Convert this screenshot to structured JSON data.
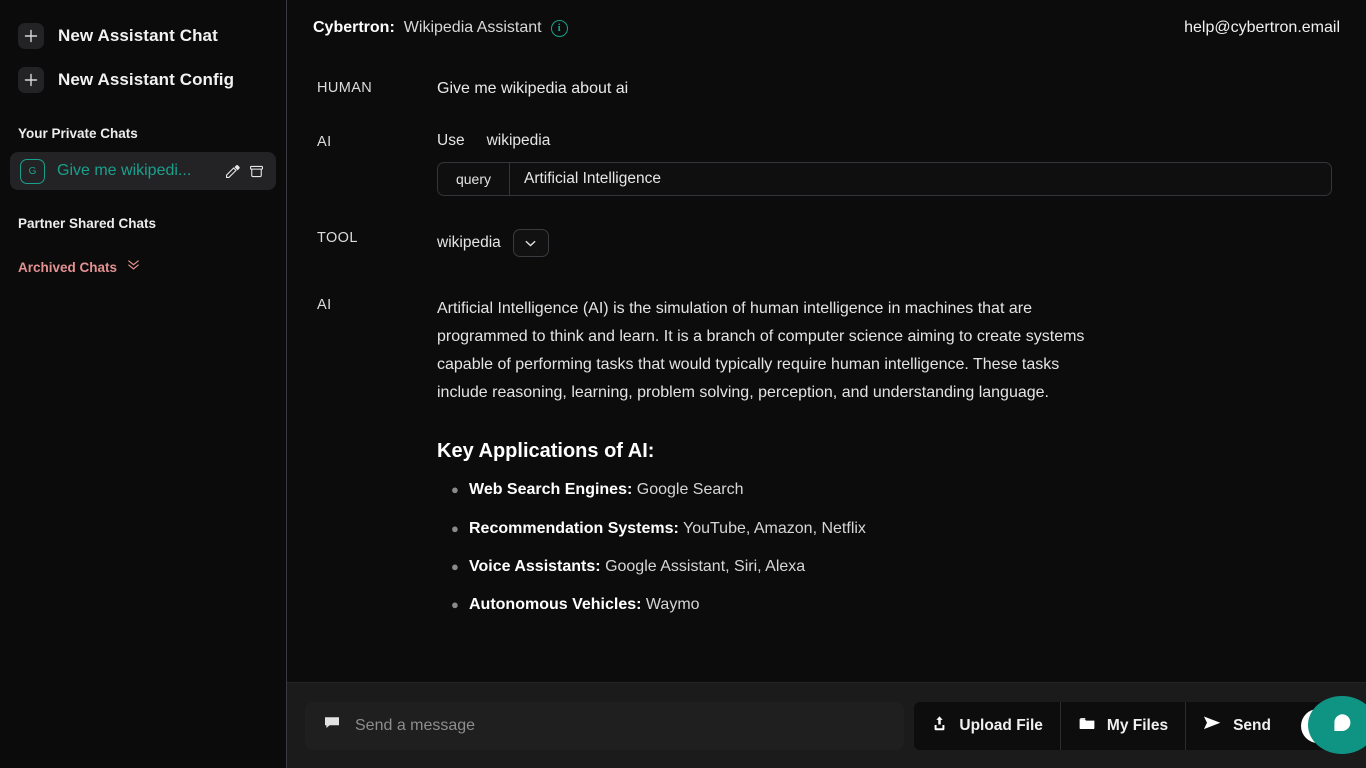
{
  "sidebar": {
    "new_chat_label": "New Assistant Chat",
    "new_config_label": "New Assistant Config",
    "private_chats_label": "Your Private Chats",
    "chat_item": {
      "avatar_initial": "G",
      "title": "Give me wikipedi...",
      "edit_icon": "edit-icon",
      "archive_icon": "archive-icon"
    },
    "partner_chats_label": "Partner Shared Chats",
    "archived_label": "Archived Chats",
    "accent_color": "#19a08c",
    "archived_color": "#e49191"
  },
  "header": {
    "title_bold": "Cybertron:",
    "title_rest": "Wikipedia Assistant",
    "info_glyph": "i",
    "account_email": "help@cybertron.email"
  },
  "conversation": {
    "human": {
      "role": "HUMAN",
      "text": "Give me wikipedia about ai"
    },
    "ai_tool_call": {
      "role": "AI",
      "use_label": "Use",
      "tool_name": "wikipedia",
      "param_key": "query",
      "param_value": "Artificial Intelligence"
    },
    "tool": {
      "role": "TOOL",
      "name": "wikipedia",
      "caret_icon": "chevron-down-icon"
    },
    "ai_answer": {
      "role": "AI",
      "paragraph": "Artificial Intelligence (AI) is the simulation of human intelligence in machines that are programmed to think and learn. It is a branch of computer science aiming to create systems capable of performing tasks that would typically require human intelligence. These tasks include reasoning, learning, problem solving, perception, and understanding language.",
      "heading": "Key Applications of AI:",
      "bullets": [
        {
          "term": "Web Search Engines:",
          "desc": "Google Search"
        },
        {
          "term": "Recommendation Systems:",
          "desc": "YouTube, Amazon, Netflix"
        },
        {
          "term": "Voice Assistants:",
          "desc": "Google Assistant, Siri, Alexa"
        },
        {
          "term": "Autonomous Vehicles:",
          "desc": "Waymo"
        }
      ]
    }
  },
  "footer": {
    "composer_placeholder": "Send a message",
    "composer_icon": "chat-bubble-icon",
    "upload_label": "Upload File",
    "upload_icon": "upload-icon",
    "files_label": "My Files",
    "files_icon": "folder-icon",
    "send_label": "Send",
    "send_icon": "send-icon",
    "mic_icon": "microphone-icon",
    "fab_icon": "chat-bubble-icon",
    "fab_color": "#0f9484"
  }
}
